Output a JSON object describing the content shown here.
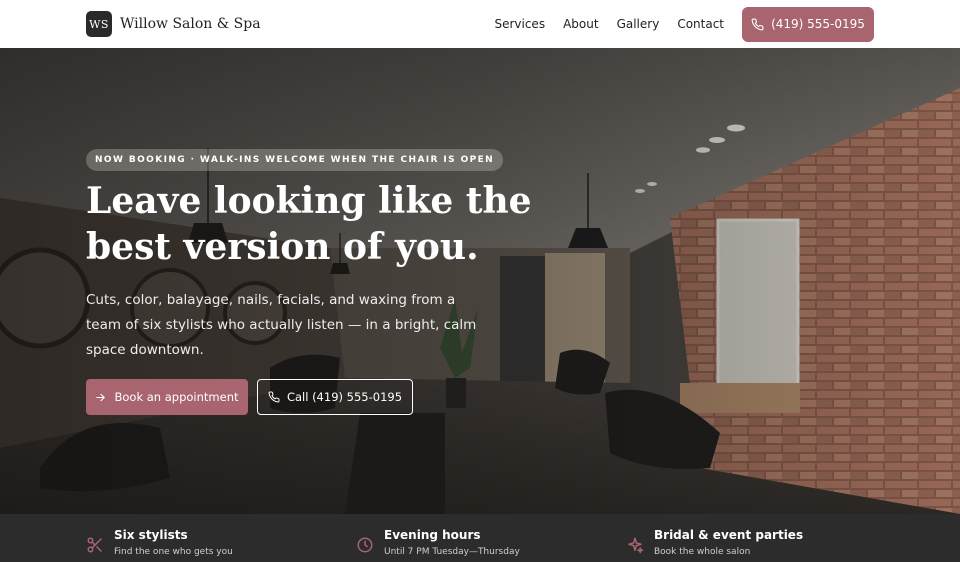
{
  "brand": {
    "mark": "WS",
    "name": "Willow Salon & Spa"
  },
  "nav": {
    "items": [
      "Services",
      "About",
      "Gallery",
      "Contact"
    ],
    "call_label": "(419) 555-0195"
  },
  "hero": {
    "eyebrow": "NOW BOOKING · WALK-INS WELCOME WHEN THE CHAIR IS OPEN",
    "headline": "Leave looking like the best version of you.",
    "subtext": "Cuts, color, balayage, nails, facials, and waxing from a team of six stylists who actually listen — in a bright, calm space downtown.",
    "book_label": "Book an appointment",
    "call_label": "Call (419) 555-0195"
  },
  "features": [
    {
      "icon": "scissors-icon",
      "title": "Six stylists",
      "subtitle": "Find the one who gets you"
    },
    {
      "icon": "clock-icon",
      "title": "Evening hours",
      "subtitle": "Until 7 PM Tuesday—Thursday"
    },
    {
      "icon": "sparkle-icon",
      "title": "Bridal & event parties",
      "subtitle": "Book the whole salon"
    }
  ],
  "colors": {
    "accent": "#a8646f",
    "header_bg": "#ffffff",
    "features_bg": "#2c2c2c"
  }
}
